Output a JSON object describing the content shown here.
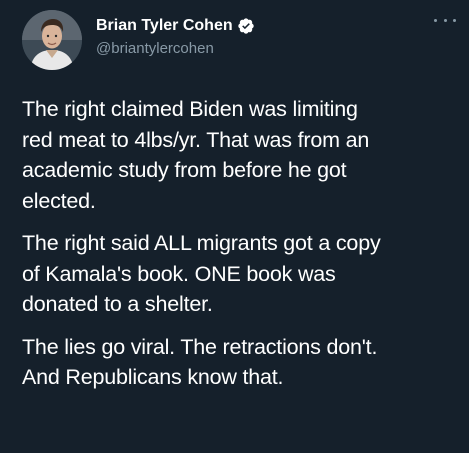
{
  "author": {
    "display_name": "Brian Tyler Cohen",
    "handle": "@briantylercohen",
    "verified": true
  },
  "icons": {
    "verified": "verified-badge-icon",
    "more": "more-options-icon"
  },
  "colors": {
    "background": "#15202b",
    "text": "#ffffff",
    "secondary_text": "#8899a6",
    "verified": "#1da1f2"
  },
  "tweet": {
    "paragraphs": [
      {
        "lines": [
          "The right claimed Biden was limiting",
          "red meat to 4lbs/yr. That was from an",
          "academic study from before he got",
          "elected."
        ]
      },
      {
        "lines": [
          "The right said ALL migrants got a copy",
          "of Kamala's book. ONE book was",
          "donated to a shelter."
        ]
      },
      {
        "lines": [
          "The lies go viral. The retractions don't.",
          "And Republicans know that."
        ]
      }
    ]
  }
}
